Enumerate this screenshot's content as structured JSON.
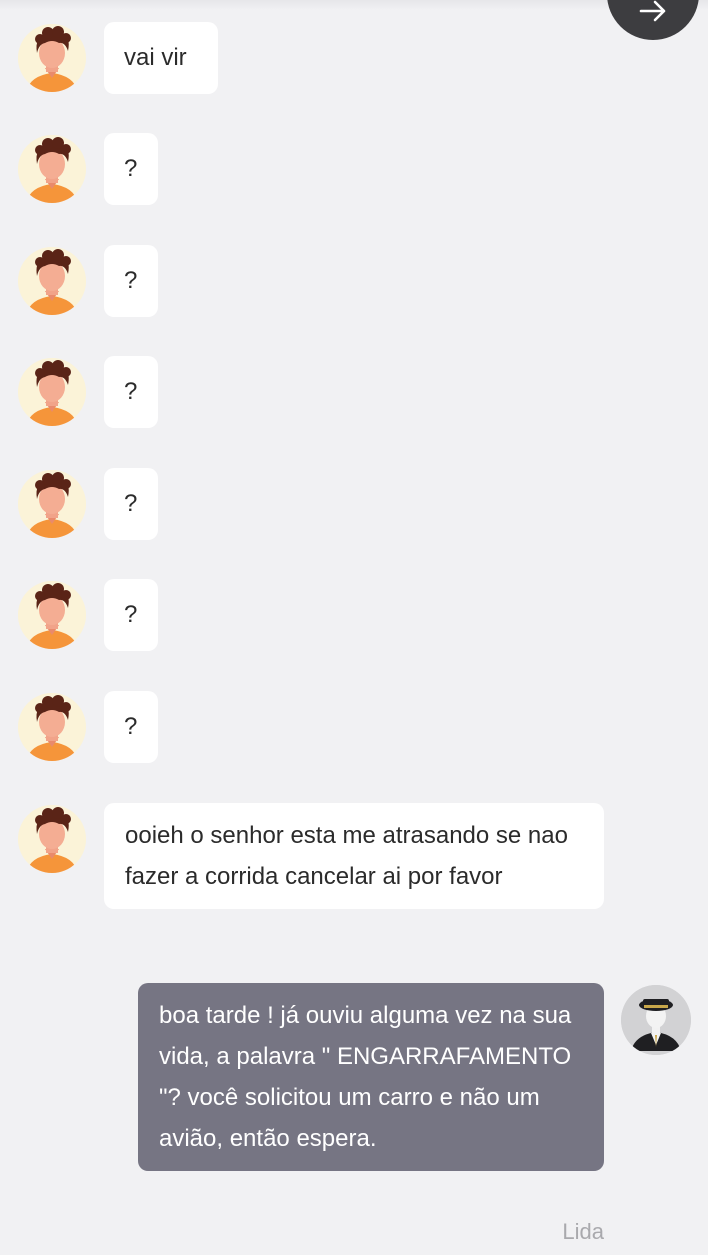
{
  "chat": {
    "incoming_messages": [
      {
        "text": "vai vir"
      },
      {
        "text": "?"
      },
      {
        "text": "?"
      },
      {
        "text": "?"
      },
      {
        "text": "?"
      },
      {
        "text": "?"
      },
      {
        "text": "?"
      },
      {
        "text": "ooieh o senhor esta me atrasando se nao fazer a corrida cancelar ai por favor"
      }
    ],
    "outgoing_message": {
      "text": "boa tarde ! já ouviu alguma vez na sua vida, a palavra \" ENGARRAFAMENTO \"? você solicitou um carro e não um avião, então espera."
    },
    "read_status": "Lida"
  },
  "icons": {
    "send_button": "arrow-right-icon",
    "incoming_avatar": "user-avatar-icon",
    "outgoing_avatar": "driver-avatar-icon"
  },
  "colors": {
    "background": "#f1f1f3",
    "incoming_bubble": "#ffffff",
    "outgoing_bubble": "#767583",
    "avatar_shirt": "#f5953a",
    "avatar_hair": "#5a2417"
  }
}
